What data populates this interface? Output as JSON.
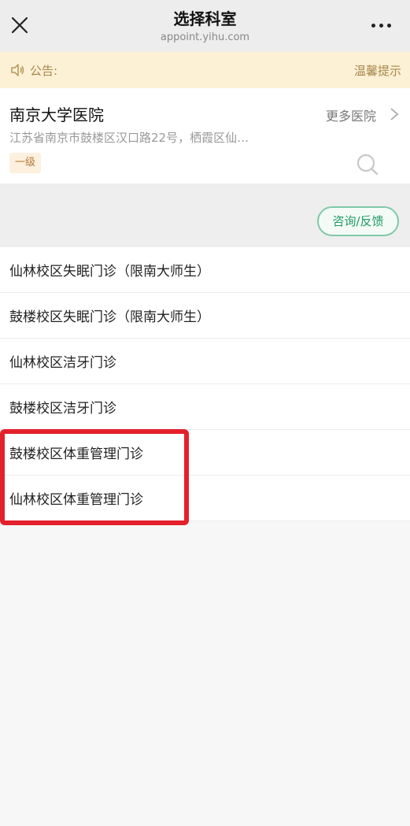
{
  "header": {
    "title": "选择科室",
    "subtitle": "appoint.yihu.com",
    "close_icon": "close-icon",
    "more_icon": "more-dots-icon"
  },
  "notice": {
    "label": "公告:",
    "text": "温馨提示",
    "icon": "speaker-icon"
  },
  "hospital": {
    "name": "南京大学医院",
    "more_label": "更多医院",
    "address": "江苏省南京市鼓楼区汉口路22号，栖霞区仙…",
    "level": "一级"
  },
  "filter": {
    "consult_label": "咨询/反馈"
  },
  "departments": [
    {
      "label": "仙林校区失眠门诊（限南大师生）"
    },
    {
      "label": "鼓楼校区失眠门诊（限南大师生）"
    },
    {
      "label": "仙林校区洁牙门诊"
    },
    {
      "label": "鼓楼校区洁牙门诊"
    },
    {
      "label": "鼓楼校区体重管理门诊"
    },
    {
      "label": "仙林校区体重管理门诊"
    }
  ],
  "colors": {
    "accent_green": "#1f9a63",
    "highlight_red": "#e3212b",
    "notice_bg": "#fcf0d5"
  }
}
